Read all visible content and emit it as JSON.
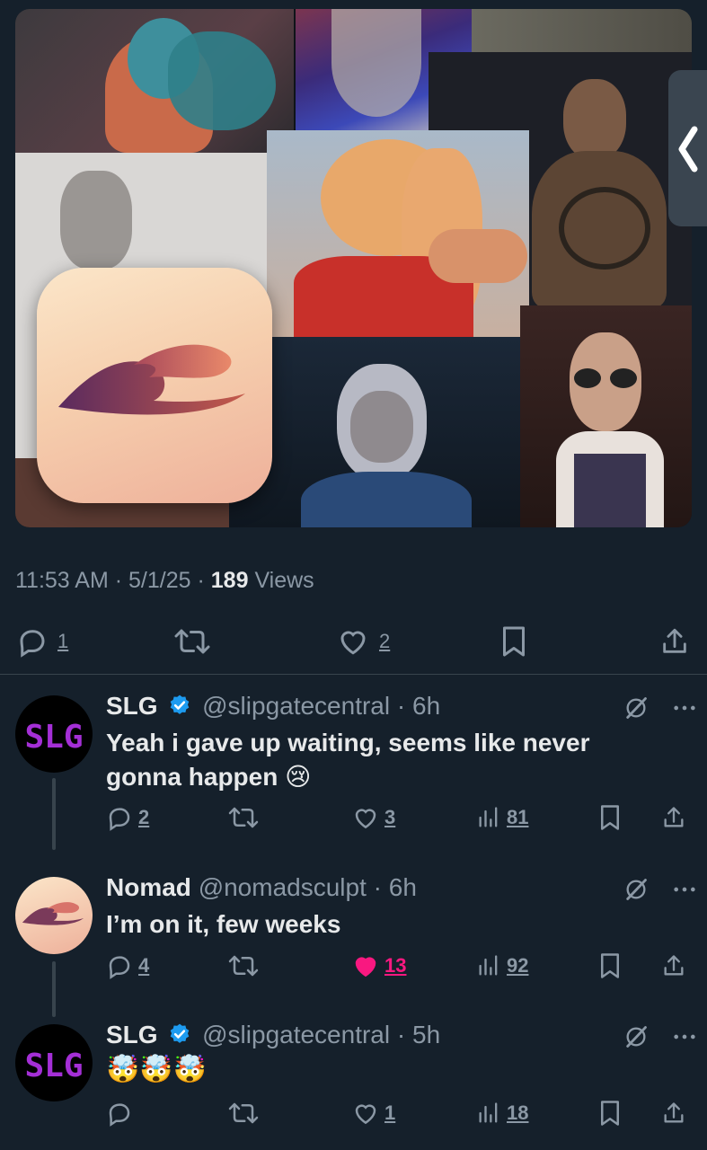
{
  "post": {
    "time": "11:53 AM",
    "date": "5/1/25",
    "views_count": "189",
    "views_label": "Views",
    "sep": "·",
    "replies": "1",
    "likes": "2"
  },
  "replies": [
    {
      "name": "SLG",
      "handle": "@slipgatecentral",
      "time": "6h",
      "verified": true,
      "text": "Yeah i gave up waiting, seems like never gonna happen 😢",
      "replies": "2",
      "likes": "3",
      "views": "81",
      "liked": false
    },
    {
      "name": "Nomad",
      "handle": "@nomadsculpt",
      "time": "6h",
      "verified": false,
      "text": "I’m on it, few weeks",
      "replies": "4",
      "likes": "13",
      "views": "92",
      "liked": true
    },
    {
      "name": "SLG",
      "handle": "@slipgatecentral",
      "time": "5h",
      "verified": true,
      "text": "🤯🤯🤯",
      "replies": "",
      "likes": "1",
      "views": "18",
      "liked": false
    }
  ],
  "colors": {
    "bg": "#15202b",
    "text": "#e7e9ea",
    "muted": "#8b98a5",
    "verified": "#1d9bf0",
    "like": "#f91880",
    "avatar_slg": "#a42fd6"
  },
  "icons": [
    "reply-icon",
    "retweet-icon",
    "like-icon",
    "bookmark-icon",
    "share-icon",
    "views-icon",
    "grok-icon",
    "more-icon",
    "verified-icon",
    "chevron-left-icon"
  ]
}
